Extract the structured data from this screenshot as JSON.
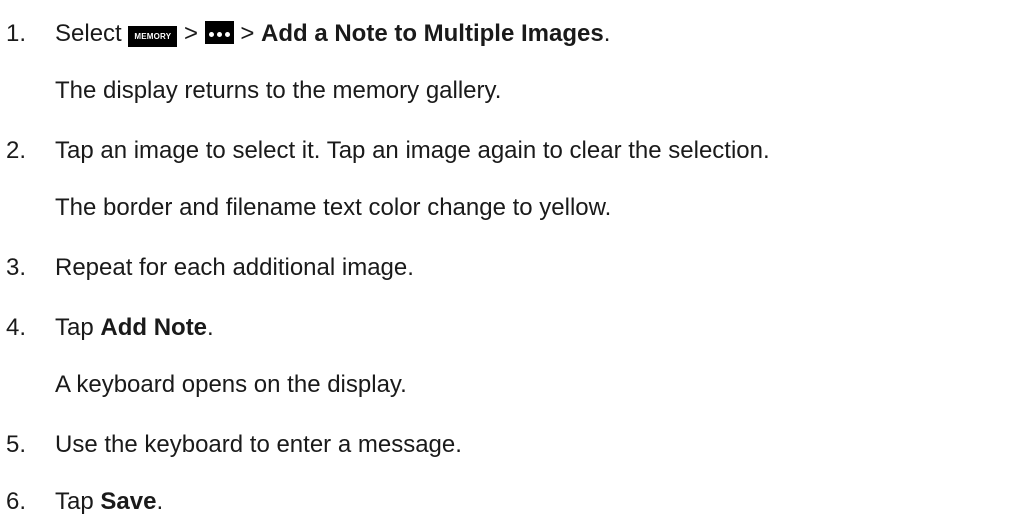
{
  "steps": [
    {
      "num": "1.",
      "pre": "Select",
      "icon1_label": "MEMORY",
      "sep1": ">",
      "icon2_name": "more-options-icon",
      "sep2": ">",
      "bold": "Add a Note to Multiple Images",
      "post": ".",
      "note": "The display returns to the memory gallery."
    },
    {
      "num": "2.",
      "text": "Tap an image to select it. Tap an image again to clear the selection.",
      "note": "The border and filename text color change to yellow."
    },
    {
      "num": "3.",
      "text": "Repeat for each additional image."
    },
    {
      "num": "4.",
      "pre": "Tap",
      "bold": "Add Note",
      "post": ".",
      "note": "A keyboard opens on the display."
    },
    {
      "num": "5.",
      "text": "Use the keyboard to enter a message."
    },
    {
      "num": "6.",
      "pre": "Tap",
      "bold": "Save",
      "post": "."
    }
  ]
}
